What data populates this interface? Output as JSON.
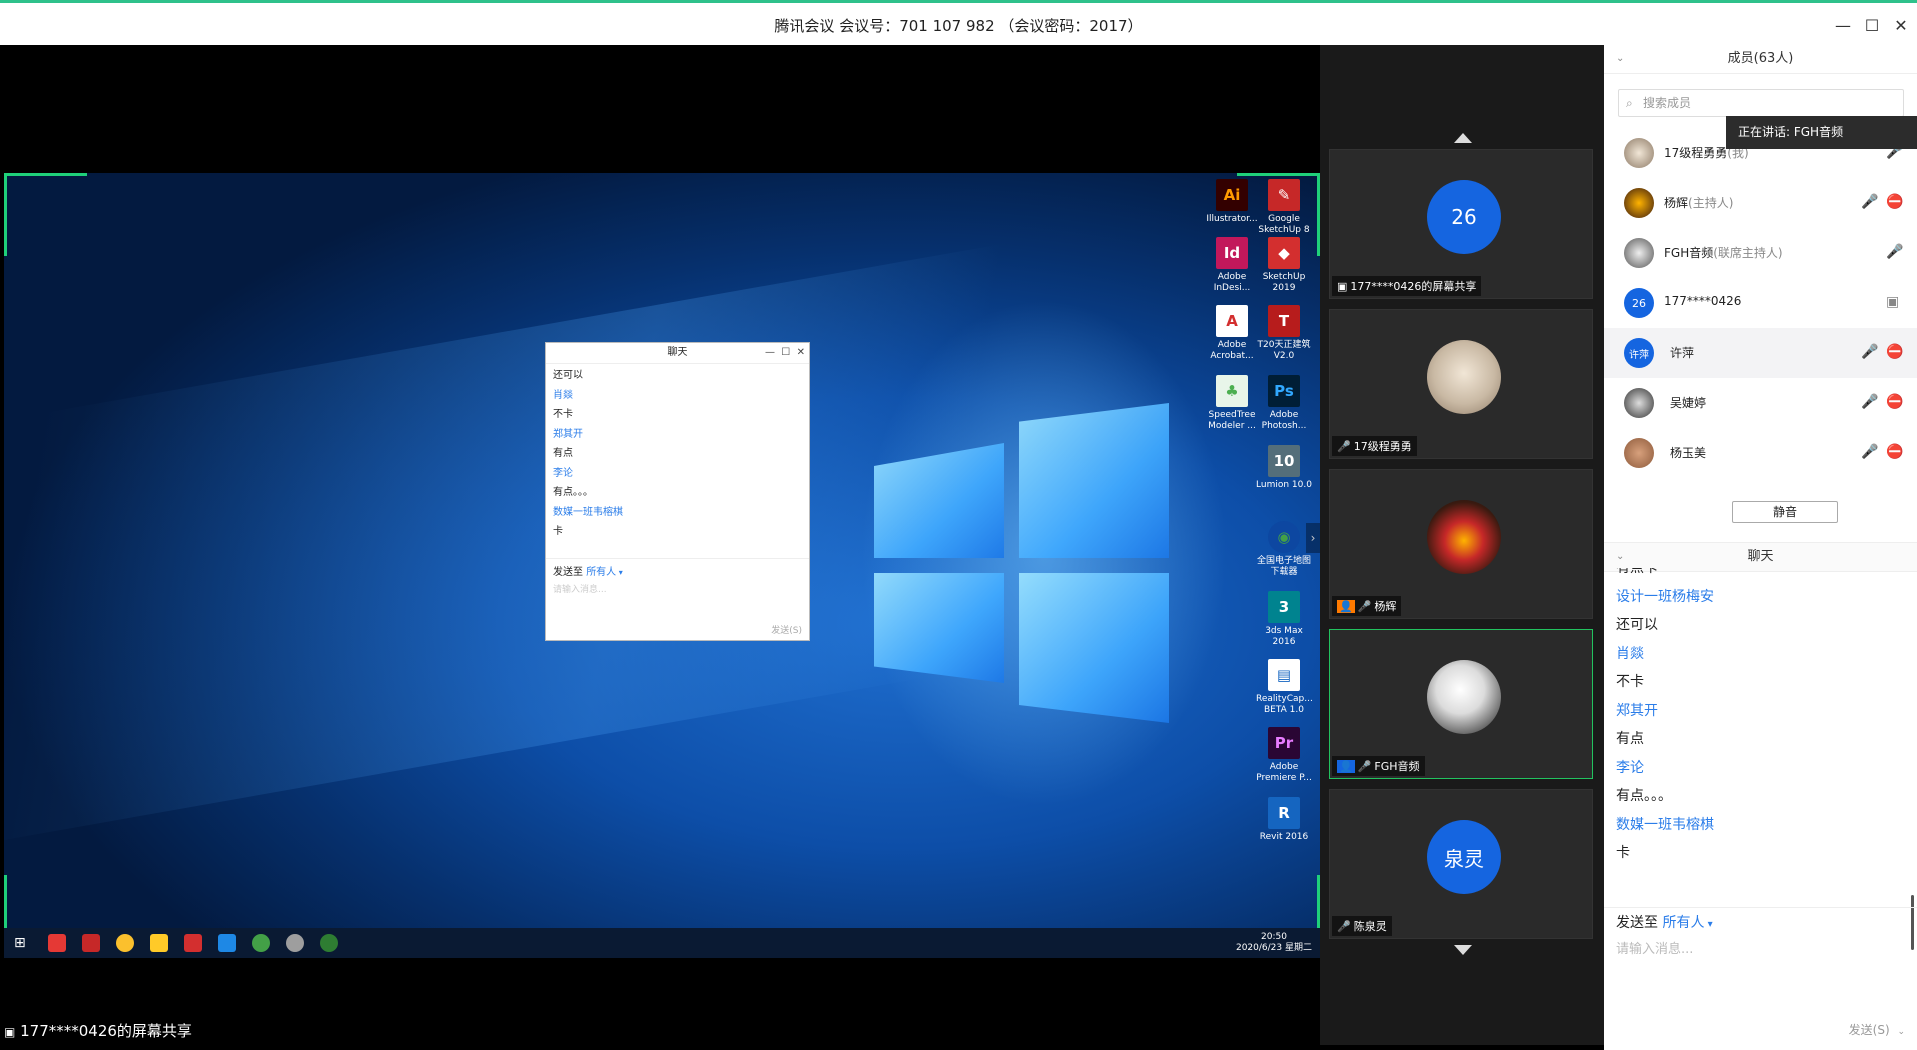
{
  "window": {
    "title": "腾讯会议 会议号：701 107 982 （会议密码：2017）",
    "controls": [
      "—",
      "☐",
      "✕"
    ]
  },
  "stage": {
    "footer_label": "177****0426的屏幕共享",
    "desktop_icons": [
      {
        "label": "Illustrator...",
        "glyph": "Ai",
        "color": "#ff9a00",
        "bg": "#330000"
      },
      {
        "label": "Google SketchUp 8",
        "glyph": "✎",
        "color": "#ffffff",
        "bg": "#c62828"
      },
      {
        "label": "Adobe InDesi...",
        "glyph": "Id",
        "color": "#ffffff",
        "bg": "#c2185b"
      },
      {
        "label": "SketchUp 2019",
        "glyph": "◆",
        "color": "#ffffff",
        "bg": "#d32f2f"
      },
      {
        "label": "Adobe Acrobat...",
        "glyph": "A",
        "color": "#d32f2f",
        "bg": "#ffffff"
      },
      {
        "label": "T20天正建筑 V2.0",
        "glyph": "T",
        "color": "#ffffff",
        "bg": "#b71c1c"
      },
      {
        "label": "SpeedTree Modeler ...",
        "glyph": "♣",
        "color": "#4caf50",
        "bg": "#e8f5e9"
      },
      {
        "label": "Adobe Photosh...",
        "glyph": "Ps",
        "color": "#31a8ff",
        "bg": "#001e36"
      },
      {
        "label": "Lumion 10.0",
        "glyph": "10",
        "color": "#ffffff",
        "bg": "#546e7a"
      },
      {
        "label": "全国电子地图下载器",
        "glyph": "◉",
        "color": "#43a047",
        "bg": "#0d47a1"
      },
      {
        "label": "3ds Max 2016",
        "glyph": "3",
        "color": "#ffffff",
        "bg": "#00838f"
      },
      {
        "label": "RealityCap... BETA 1.0",
        "glyph": "▤",
        "color": "#1565c0",
        "bg": "#ffffff"
      },
      {
        "label": "Adobe Premiere P...",
        "glyph": "Pr",
        "color": "#e77cff",
        "bg": "#2a0634"
      },
      {
        "label": "Revit 2016",
        "glyph": "R",
        "color": "#ffffff",
        "bg": "#1565c0"
      }
    ],
    "taskbar": {
      "time": "20:50",
      "date": "2020/6/23 星期二"
    },
    "chat_window": {
      "title": "聊天",
      "messages": [
        {
          "name": "",
          "text": "还可以"
        },
        {
          "name": "肖燚",
          "text": ""
        },
        {
          "name": "",
          "text": "不卡"
        },
        {
          "name": "郑其开",
          "text": ""
        },
        {
          "name": "",
          "text": "有点"
        },
        {
          "name": "李论",
          "text": ""
        },
        {
          "name": "",
          "text": "有点。。。"
        },
        {
          "name": "数媒一班韦榕棋",
          "text": ""
        },
        {
          "name": "",
          "text": "卡"
        }
      ],
      "send_to_label": "发送至",
      "send_to_target": "所有人",
      "placeholder": "请输入消息...",
      "send_button": "发送(S)"
    }
  },
  "video_tiles": [
    {
      "avatar_text": "26",
      "avatar_color": "#1565e0",
      "label": "177****0426的屏幕共享",
      "icon": "screen-share"
    },
    {
      "avatar_text": "",
      "avatar_color": "#c9b9a4",
      "label": "17级程勇勇",
      "icon": "mic-on"
    },
    {
      "avatar_text": "",
      "avatar_color": "#3a1a10",
      "label": "杨辉",
      "icon": "host-mic-off"
    },
    {
      "avatar_text": "",
      "avatar_color": "#dcdcdc",
      "label": "FGH音频",
      "icon": "mic-on",
      "active": true
    },
    {
      "avatar_text": "泉灵",
      "avatar_color": "#1565e0",
      "label": "陈泉灵",
      "icon": "mic-off"
    }
  ],
  "members": {
    "header": "成员(63人)",
    "search_placeholder": "搜索成员",
    "speaking_tooltip": "正在讲话: FGH音频",
    "list": [
      {
        "name": "17级程勇勇",
        "role": "(我)",
        "avatar_text": "",
        "avatar_color": "#c9b9a4",
        "mic": "on",
        "cam": ""
      },
      {
        "name": "杨辉",
        "role": "(主持人)",
        "avatar_text": "",
        "avatar_color": "#3a1a10",
        "mic": "off",
        "cam": "off"
      },
      {
        "name": "FGH音频",
        "role": "(联席主持人)",
        "avatar_text": "",
        "avatar_color": "#555555",
        "mic": "on",
        "cam": ""
      },
      {
        "name": "177****0426",
        "role": "",
        "avatar_text": "26",
        "avatar_color": "#1565e0",
        "mic": "",
        "cam": "screen"
      },
      {
        "name": "许萍",
        "role": "",
        "avatar_text": "许萍",
        "avatar_color": "#1565e0",
        "mic": "off",
        "cam": "off"
      },
      {
        "name": "吴婕婷",
        "role": "",
        "avatar_text": "",
        "avatar_color": "#333333",
        "mic": "off",
        "cam": "off"
      },
      {
        "name": "杨玉美",
        "role": "",
        "avatar_text": "",
        "avatar_color": "#8d5a3b",
        "mic": "off",
        "cam": "off"
      }
    ],
    "mute_all": "静音"
  },
  "chat": {
    "header": "聊天",
    "messages": [
      {
        "name": "",
        "text": "有点卡"
      },
      {
        "name": "设计一班杨梅安",
        "text": ""
      },
      {
        "name": "",
        "text": "还可以"
      },
      {
        "name": "肖燚",
        "text": ""
      },
      {
        "name": "",
        "text": "不卡"
      },
      {
        "name": "郑其开",
        "text": ""
      },
      {
        "name": "",
        "text": "有点"
      },
      {
        "name": "李论",
        "text": ""
      },
      {
        "name": "",
        "text": "有点。。。"
      },
      {
        "name": "数媒一班韦榕棋",
        "text": ""
      },
      {
        "name": "",
        "text": "卡"
      }
    ],
    "send_to_label": "发送至",
    "send_to_target": "所有人",
    "placeholder": "请输入消息...",
    "send_button": "发送(S)"
  },
  "colors": {
    "accent": "#2fc18b",
    "link": "#2b7de9",
    "active_border": "#22c25f"
  }
}
